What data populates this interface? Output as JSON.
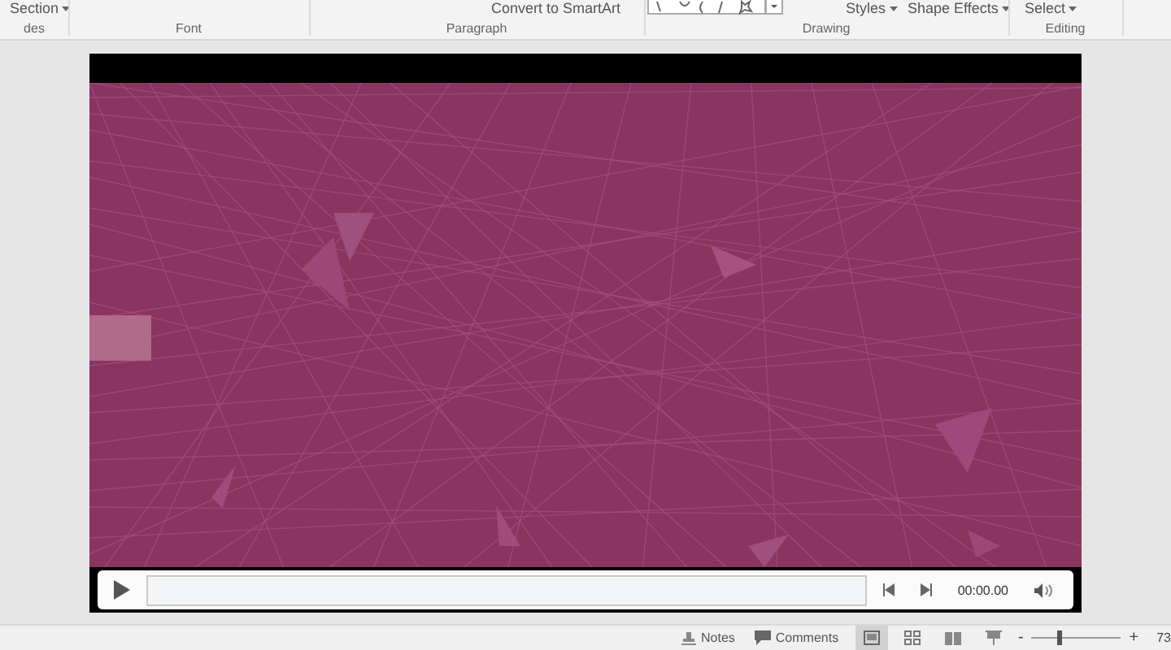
{
  "ribbon": {
    "commands": [
      {
        "kind": "dropdown",
        "label": "Section"
      },
      {
        "kind": "button",
        "label": "Convert to SmartArt"
      },
      {
        "kind": "shapes"
      },
      {
        "kind": "dropdown",
        "label": "Styles"
      },
      {
        "kind": "dropdown",
        "label": "Shape Effects"
      },
      {
        "kind": "dropdown",
        "label": "Select"
      }
    ],
    "groups": [
      "des",
      "Font",
      "Paragraph",
      "Drawing",
      "Editing"
    ]
  },
  "player": {
    "time": "00:00.00"
  },
  "status_bar": {
    "notes": "Notes",
    "comments": "Comments",
    "views": [
      {
        "kind": "normal",
        "selected": true
      },
      {
        "kind": "sorter",
        "selected": false
      },
      {
        "kind": "reading",
        "selected": false
      },
      {
        "kind": "show",
        "selected": false
      }
    ],
    "zoom": {
      "minus": "-",
      "plus": "+",
      "level": 0.3,
      "value": "73"
    }
  }
}
